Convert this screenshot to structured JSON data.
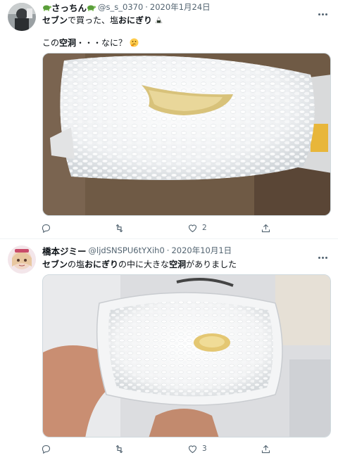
{
  "tweets": [
    {
      "name": "さっちん",
      "handle": "@s_s_0370",
      "separator": "·",
      "date": "2020年1月24日",
      "line1_parts": [
        "セブン",
        "で買った、塩",
        "おにぎり",
        ""
      ],
      "line2_parts": [
        "この",
        "空洞",
        "・・・なに？"
      ],
      "emoji_line1": "onigiri-emoji",
      "emoji_line2": "thinking-face-emoji",
      "photo": "onigiri-with-cavity-photo",
      "like_count": "2"
    },
    {
      "name": "橋本ジミー",
      "handle": "@ljdSNSPU6tYXih0",
      "separator": "·",
      "date": "2020年10月1日",
      "line1_parts": [
        "セブン",
        "の塩",
        "おにぎり",
        "の中に大きな",
        "空洞",
        "がありました"
      ],
      "photo": "hand-holding-onigiri-photo",
      "like_count": "3"
    }
  ],
  "icons": {
    "reply": "reply-icon",
    "retweet": "retweet-icon",
    "like": "heart-icon",
    "share": "share-icon",
    "more": "more-icon"
  },
  "colors": {
    "text": "#0f1419",
    "secondary": "#536471",
    "divider": "#eff3f4"
  }
}
